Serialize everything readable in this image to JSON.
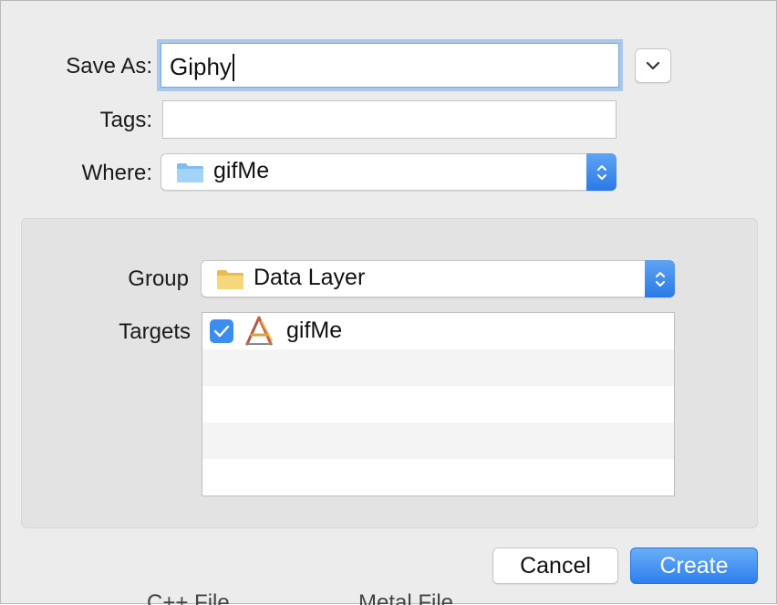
{
  "form": {
    "save_as_label": "Save As:",
    "save_as_value": "Giphy",
    "tags_label": "Tags:",
    "tags_value": "",
    "where_label": "Where:",
    "where_value": "gifMe"
  },
  "options": {
    "group_label": "Group",
    "group_value": "Data Layer",
    "targets_label": "Targets",
    "targets": [
      {
        "label": "gifMe",
        "checked": true,
        "icon": "xcode-app-icon"
      }
    ]
  },
  "buttons": {
    "cancel_label": "Cancel",
    "create_label": "Create"
  },
  "background_text": {
    "left": "C++ File",
    "right": "Metal File"
  },
  "colors": {
    "accent": "#3b8df0",
    "folder_blue": "#8fc7f2",
    "folder_yellow": "#f2cf6b"
  }
}
